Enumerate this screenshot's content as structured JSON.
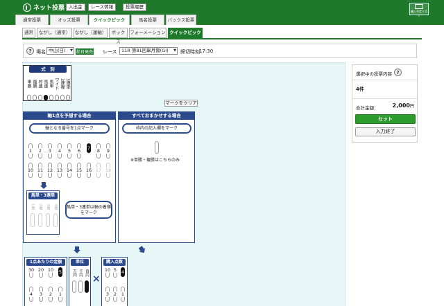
{
  "header": {
    "logo": "ネット投票",
    "buttons": [
      "入出金",
      "レース情報",
      "投票履歴"
    ],
    "side_button": "購入予定リスト",
    "tabs": [
      "通常投票",
      "オッズ投票",
      "クイックピック",
      "馬名投票",
      "バックス投票"
    ],
    "active_tab": 2
  },
  "subtabs": {
    "items": [
      "通常",
      "ながし（通常）",
      "ながし（運軸）",
      "ボックス",
      "フォーメーション",
      "クイックピック"
    ],
    "active": 5
  },
  "race": {
    "venue_label": "場名",
    "venue_value": "中山(日)",
    "badge": "前日発売",
    "race_label": "レース",
    "race_value": "11R 第81回皐月賞(GI)",
    "deadline_label": "締切時刻",
    "deadline_value": "17:30"
  },
  "bet_types": {
    "title": "式　別",
    "items": [
      {
        "label": "単勝",
        "selected": false
      },
      {
        "label": "複勝",
        "selected": false
      },
      {
        "label": "枠連",
        "selected": false
      },
      {
        "label": "馬連",
        "selected": true
      },
      {
        "label": "馬単",
        "selected": false
      },
      {
        "label": "ワイド",
        "selected": false
      },
      {
        "label": "3連複",
        "selected": false
      },
      {
        "label": "3連単",
        "selected": false
      }
    ]
  },
  "clear_button": "マークをクリア",
  "axis_panel": {
    "title": "軸1点を予想する場合",
    "bubble": "軸となる番号を1点マーク",
    "numbers": [
      {
        "n": "1",
        "selected": false,
        "disabled": false
      },
      {
        "n": "2",
        "selected": false,
        "disabled": false
      },
      {
        "n": "3",
        "selected": false,
        "disabled": false
      },
      {
        "n": "4",
        "selected": false,
        "disabled": false
      },
      {
        "n": "5",
        "selected": false,
        "disabled": false
      },
      {
        "n": "6",
        "selected": false,
        "disabled": false
      },
      {
        "n": "7",
        "selected": true,
        "disabled": false
      },
      {
        "n": "8",
        "selected": false,
        "disabled": false
      },
      {
        "n": "9",
        "selected": false,
        "disabled": false
      },
      {
        "n": "10",
        "selected": false,
        "disabled": false
      },
      {
        "n": "11",
        "selected": false,
        "disabled": false
      },
      {
        "n": "12",
        "selected": false,
        "disabled": false
      },
      {
        "n": "13",
        "selected": false,
        "disabled": false
      },
      {
        "n": "14",
        "selected": false,
        "disabled": false
      },
      {
        "n": "15",
        "selected": false,
        "disabled": false
      },
      {
        "n": "16",
        "selected": false,
        "disabled": false
      },
      {
        "n": "17",
        "selected": false,
        "disabled": true
      },
      {
        "n": "18",
        "selected": false,
        "disabled": true
      }
    ],
    "sub_title": "馬単・3連単",
    "sub_cols": [
      "1着",
      "2着",
      "3着",
      "4着"
    ],
    "sub_bubble": "馬単・3連単は軸の着順をマーク"
  },
  "all_panel": {
    "title": "すべておまかせする場合",
    "bubble": "枠内の記入欄をマーク",
    "note": "※単勝・複勝はこちらのみ"
  },
  "amount_panel": {
    "title": "1点あたりの金額",
    "top": [
      "30",
      "20",
      "10",
      "5"
    ],
    "bottom": [
      "4",
      "3",
      "2",
      "1"
    ]
  },
  "unit_panel": {
    "title": "単位",
    "top": [
      "万円",
      "千円",
      "百円"
    ]
  },
  "purchase_panel": {
    "title": "購入点数",
    "top": [
      "10",
      "5",
      "4"
    ],
    "bottom": [
      "3",
      "2",
      "1"
    ]
  },
  "summary": {
    "title": "選択中の投票内容",
    "count": "4件",
    "total_label": "合計金額：",
    "total_value": "2,000",
    "yen": "円",
    "set_button": "セット",
    "done_button": "入力終了"
  },
  "colors": {
    "brand": "#1e7a2a",
    "panel": "#2b4a8e",
    "bg": "#e7f6f7"
  }
}
